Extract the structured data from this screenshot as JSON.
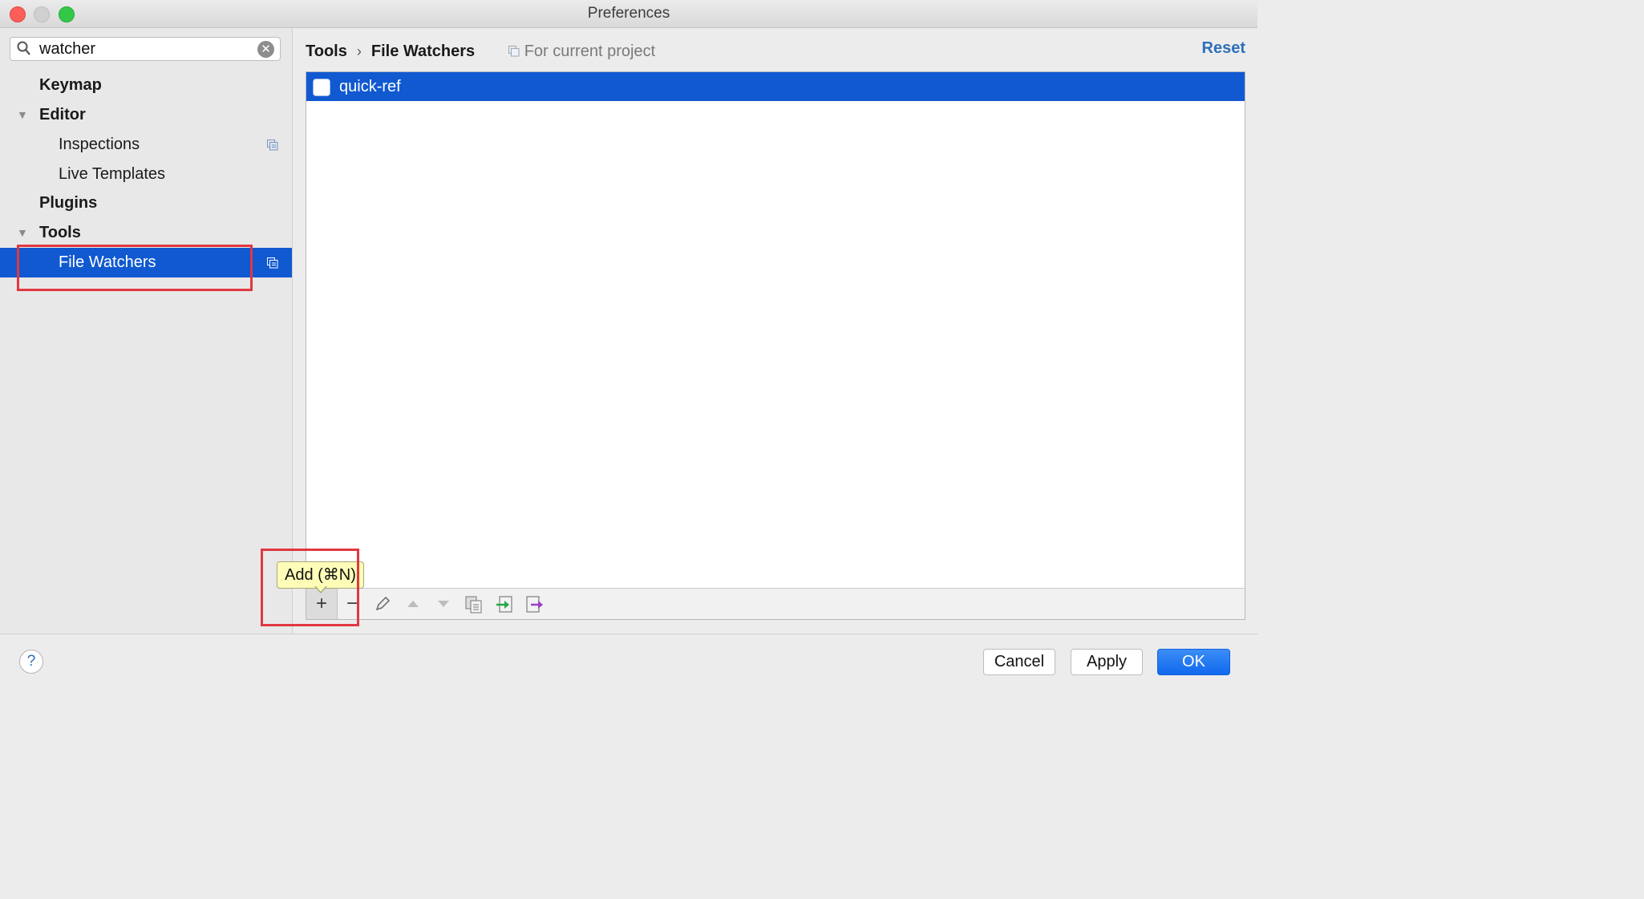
{
  "window": {
    "title": "Preferences"
  },
  "sidebar": {
    "search": {
      "value": "watcher"
    },
    "items": [
      {
        "label": "Keymap"
      },
      {
        "label": "Editor"
      },
      {
        "label": "Inspections"
      },
      {
        "label": "Live Templates"
      },
      {
        "label": "Plugins"
      },
      {
        "label": "Tools"
      },
      {
        "label": "File Watchers"
      }
    ]
  },
  "content": {
    "breadcrumb": {
      "parent": "Tools",
      "separator": "›",
      "current": "File Watchers",
      "scope": "For current project"
    },
    "reset_label": "Reset",
    "watchers": [
      {
        "name": "quick-ref",
        "enabled": false
      }
    ],
    "toolbar": {
      "add_label": "+",
      "remove_label": "−",
      "tooltip": "Add (⌘N)"
    }
  },
  "footer": {
    "help_label": "?",
    "cancel_label": "Cancel",
    "apply_label": "Apply",
    "ok_label": "OK"
  },
  "colors": {
    "selection": "#1059d1",
    "highlight_box": "#e03841",
    "link": "#2d6fba"
  },
  "icons": [
    "search-icon",
    "clear-search-icon",
    "project-scope-icon",
    "edit-icon",
    "move-up-icon",
    "move-down-icon",
    "copy-icon",
    "import-icon",
    "export-icon",
    "help-icon"
  ]
}
